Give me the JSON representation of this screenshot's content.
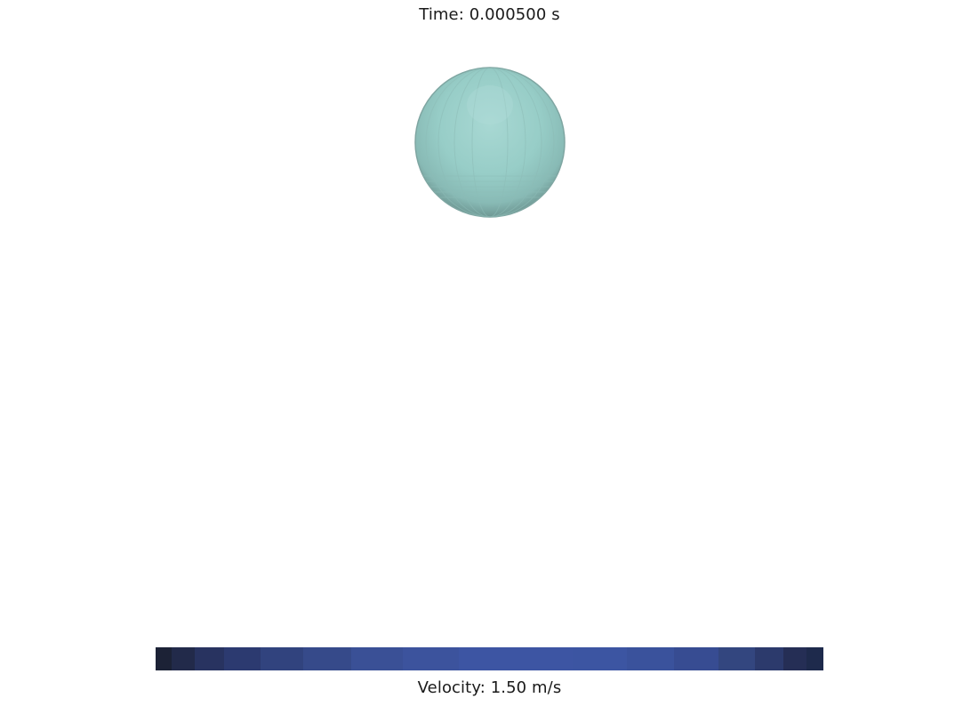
{
  "overlay": {
    "time_text": "Time: 0.000500 s",
    "velocity_text": "Velocity: 1.50 m/s"
  },
  "scene": {
    "object": "sphere",
    "sphere_color": "#97cdc7",
    "sphere_highlight": "#a6d6d1",
    "sphere_shadow": "#6f9b97",
    "background": "#ffffff"
  },
  "colorbar": {
    "colors": [
      "#1c2236",
      "#222a4a",
      "#283360",
      "#2c3a70",
      "#31437e",
      "#364a8a",
      "#3a5096",
      "#3c539d",
      "#3d55a3",
      "#3c55a2",
      "#3a529c",
      "#374c92",
      "#33467f",
      "#2c3a6c",
      "#252e55",
      "#1e2a4c"
    ]
  }
}
